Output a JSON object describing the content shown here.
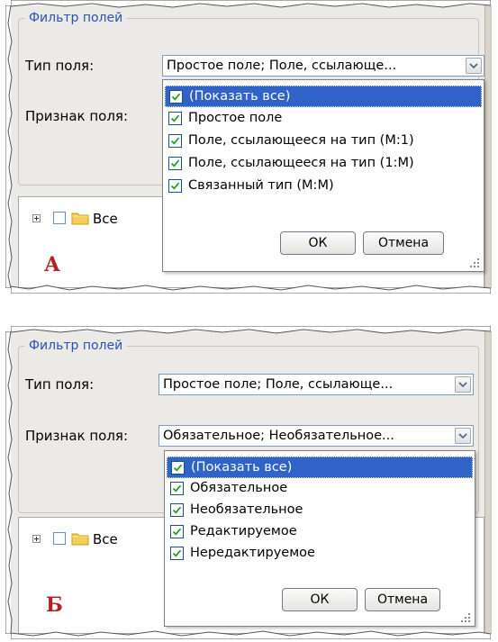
{
  "panel_a": {
    "legend": "Фильтр полей",
    "field_type_label": "Тип поля:",
    "field_type_value": "Простое поле; Поле, ссылающе...",
    "field_attr_label": "Признак поля:",
    "tree_item": "Все",
    "popup_options": [
      {
        "label": "(Показать все)",
        "checked": true,
        "selected": true
      },
      {
        "label": "Простое поле",
        "checked": true,
        "selected": false
      },
      {
        "label": "Поле, ссылающееся на тип (M:1)",
        "checked": true,
        "selected": false
      },
      {
        "label": "Поле, ссылающееся на тип (1:M)",
        "checked": true,
        "selected": false
      },
      {
        "label": "Связанный тип (M:M)",
        "checked": true,
        "selected": false
      }
    ],
    "ok_label": "ОК",
    "cancel_label": "Отмена",
    "mark": "А"
  },
  "panel_b": {
    "legend": "Фильтр полей",
    "field_type_label": "Тип поля:",
    "field_type_value": "Простое поле; Поле, ссылающе...",
    "field_attr_label": "Признак поля:",
    "field_attr_value": "Обязательное; Необязательное...",
    "tree_item": "Все",
    "popup_options": [
      {
        "label": "(Показать все)",
        "checked": true,
        "selected": true
      },
      {
        "label": "Обязательное",
        "checked": true,
        "selected": false
      },
      {
        "label": "Необязательное",
        "checked": true,
        "selected": false
      },
      {
        "label": "Редактируемое",
        "checked": true,
        "selected": false
      },
      {
        "label": "Нередактируемое",
        "checked": true,
        "selected": false
      }
    ],
    "ok_label": "ОК",
    "cancel_label": "Отмена",
    "mark": "Б"
  },
  "icons": [
    "chevron-down-icon",
    "checkbox-checked-icon",
    "folder-icon",
    "expand-plus-icon",
    "resize-grip-icon"
  ],
  "colors": {
    "selection": "#2f63c8",
    "legend": "#2a50b8",
    "mark": "#b22222",
    "panel_bg": "#eceae6"
  }
}
